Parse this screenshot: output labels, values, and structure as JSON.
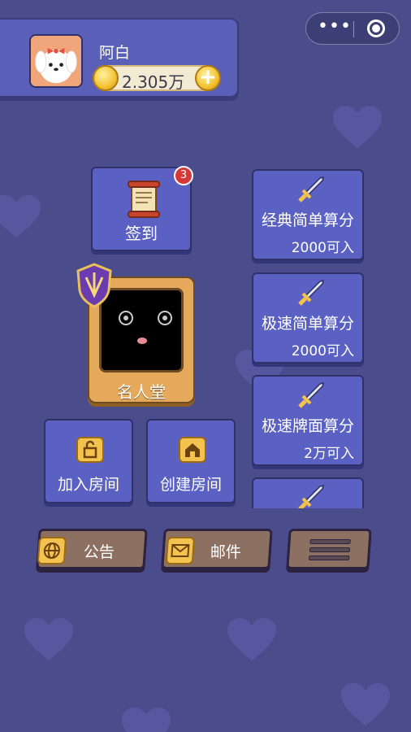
{
  "profile": {
    "username": "阿白",
    "coins": "2.305万"
  },
  "signin": {
    "label": "签到",
    "badge_count": "3"
  },
  "hall_of_fame": {
    "label": "名人堂"
  },
  "rooms": {
    "join_label": "加入房间",
    "create_label": "创建房间"
  },
  "modes": [
    {
      "title": "经典简单算分",
      "cost": "2000可入"
    },
    {
      "title": "极速简单算分",
      "cost": "2000可入"
    },
    {
      "title": "极速牌面算分",
      "cost": "2万可入"
    }
  ],
  "bottom_bar": {
    "notice_label": "公告",
    "mail_label": "邮件"
  },
  "capsule": {
    "more_icon": "more-dots-icon",
    "close_icon": "close-target-icon"
  },
  "colors": {
    "background": "#4b4c8c",
    "tile": "#5a61c2",
    "gold": "#f4c24f",
    "wood": "#8c7062"
  }
}
